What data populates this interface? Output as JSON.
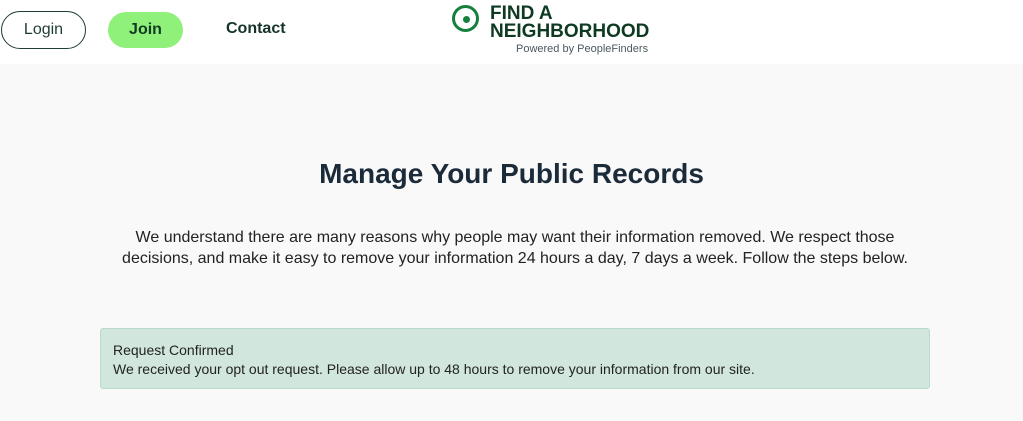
{
  "nav": {
    "login_label": "Login",
    "join_label": "Join",
    "contact_label": "Contact"
  },
  "logo": {
    "line1": "FIND A",
    "line2": "NEIGHBORHOOD",
    "subtitle": "Powered by PeopleFinders",
    "icon": "target-circle-icon"
  },
  "main": {
    "title": "Manage Your Public Records",
    "intro": "We understand there are many reasons why people may want their information removed. We respect those decisions, and make it easy to remove your information 24 hours a day, 7 days a week. Follow the steps below."
  },
  "alert": {
    "title": "Request Confirmed",
    "message": "We received your opt out request. Please allow up to 48 hours to remove your information from our site."
  },
  "colors": {
    "brand_green": "#15803d",
    "join_button": "#8ff07a",
    "alert_bg": "#d1e7dd",
    "page_bg": "#f9f9f9"
  }
}
